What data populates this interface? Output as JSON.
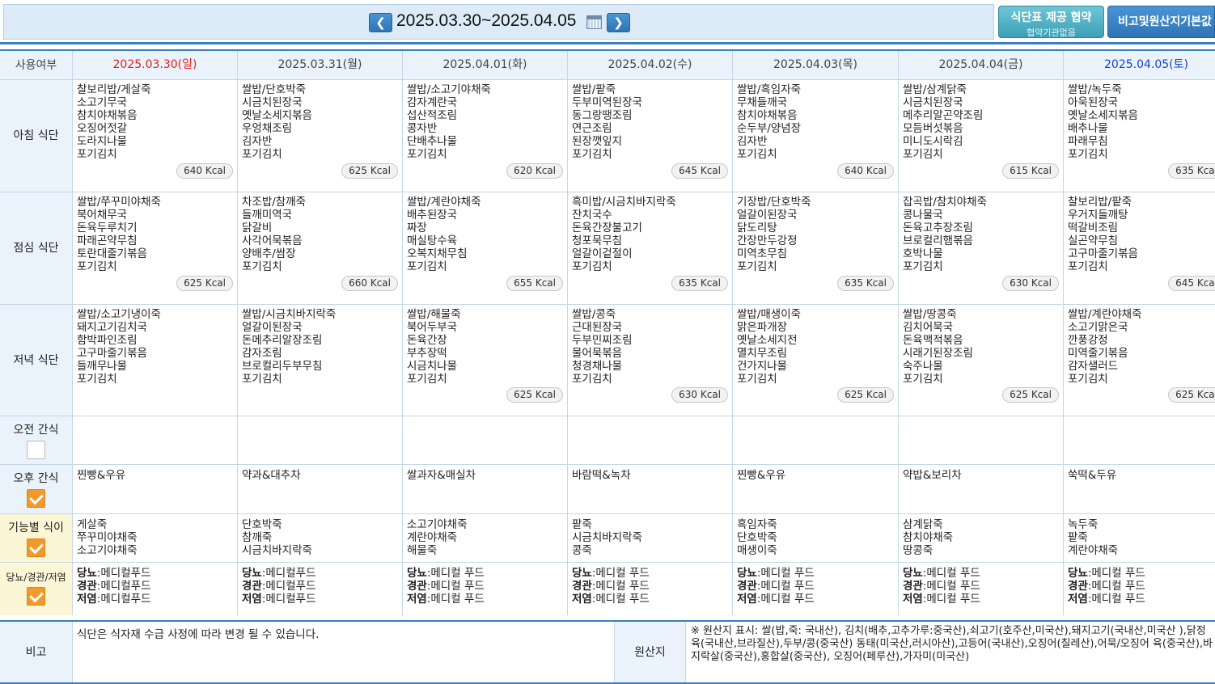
{
  "header": {
    "prev_icon": "chevron-left-icon",
    "next_icon": "chevron-right-icon",
    "prev_glyph": "❮",
    "next_glyph": "❯",
    "date_range": "2025.03.30~2025.04.05",
    "agree_button_title": "식단표 제공 협약",
    "agree_button_sub": "협약기관없음",
    "note_button": "비고및원산지기본값"
  },
  "table": {
    "col_header_label": "사용여부",
    "days": [
      {
        "date": "2025.03.30(일)",
        "kind": "sun"
      },
      {
        "date": "2025.03.31(월)",
        "kind": ""
      },
      {
        "date": "2025.04.01(화)",
        "kind": ""
      },
      {
        "date": "2025.04.02(수)",
        "kind": ""
      },
      {
        "date": "2025.04.03(목)",
        "kind": ""
      },
      {
        "date": "2025.04.04(금)",
        "kind": ""
      },
      {
        "date": "2025.04.05(토)",
        "kind": "sat"
      }
    ],
    "rows": {
      "breakfast": {
        "label": "아침 식단",
        "cells": [
          {
            "items": [
              "찰보리밥/게살죽",
              "소고기무국",
              "참치야채볶음",
              "오징어젓갈",
              "도라지나물",
              "포기김치"
            ],
            "kcal": "640 Kcal"
          },
          {
            "items": [
              "쌀밥/단호박죽",
              "시금치된장국",
              "옛날소세지볶음",
              "우엉채조림",
              "김자반",
              "포기김치"
            ],
            "kcal": "625 Kcal"
          },
          {
            "items": [
              "쌀밥/소고기야채죽",
              "감자계란국",
              "섭산적조림",
              "콩자반",
              "단배추나물",
              "포기김치"
            ],
            "kcal": "620 Kcal"
          },
          {
            "items": [
              "쌀밥/팥죽",
              "두부미역된장국",
              "동그랑땡조림",
              "연근조림",
              "된장깻잎지",
              "포기김치"
            ],
            "kcal": "645 Kcal"
          },
          {
            "items": [
              "쌀밥/흑임자죽",
              "무채들깨국",
              "참치야채볶음",
              "순두부/양념장",
              "김자반",
              "포기김치"
            ],
            "kcal": "640 Kcal"
          },
          {
            "items": [
              "쌀밥/삼계닭죽",
              "시금치된장국",
              "메추리알곤약조림",
              "모듬버섯볶음",
              "미니도시락김",
              "포기김치"
            ],
            "kcal": "615 Kcal"
          },
          {
            "items": [
              "쌀밥/녹두죽",
              "아욱된장국",
              "옛날소세지볶음",
              "배추나물",
              "파래무침",
              "포기김치"
            ],
            "kcal": "635 Kcal"
          }
        ]
      },
      "lunch": {
        "label": "점심 식단",
        "cells": [
          {
            "items": [
              "쌀밥/쭈꾸미야채죽",
              "북어채무국",
              "돈육두루치기",
              "파래곤약무침",
              "토란대줄기볶음",
              "포기김치"
            ],
            "kcal": "625 Kcal"
          },
          {
            "items": [
              "차조밥/참깨죽",
              "들깨미역국",
              "닭갈비",
              "사각어묵볶음",
              "양배추/쌈장",
              "포기김치"
            ],
            "kcal": "660 Kcal"
          },
          {
            "items": [
              "쌀밥/계란야채죽",
              "배추된장국",
              "짜장",
              "매실탕수육",
              "오복지채무침",
              "포기김치"
            ],
            "kcal": "655 Kcal"
          },
          {
            "items": [
              "흑미밥/시금치바지락죽",
              "잔치국수",
              "돈육간장불고기",
              "청포묵무침",
              "얼갈이겉절이",
              "포기김치"
            ],
            "kcal": "635 Kcal"
          },
          {
            "items": [
              "기장밥/단호박죽",
              "얼갈이된장국",
              "닭도리탕",
              "간장만두강정",
              "미역초무침",
              "포기김치"
            ],
            "kcal": "635 Kcal"
          },
          {
            "items": [
              "잡곡밥/참치야채죽",
              "콩나물국",
              "돈육고추장조림",
              "브로컬리햄볶음",
              "호박나물",
              "포기김치"
            ],
            "kcal": "630 Kcal"
          },
          {
            "items": [
              "찰보리밥/팥죽",
              "우거지들깨탕",
              "떡갈비조림",
              "실곤약무침",
              "고구마줄기볶음",
              "포기김치"
            ],
            "kcal": "645 Kcal"
          }
        ]
      },
      "dinner": {
        "label": "저녁 식단",
        "cells": [
          {
            "items": [
              "쌀밥/소고기냉이죽",
              "돼지고기김치국",
              "함박파인조림",
              "고구마줄기볶음",
              "들깨무나물",
              "포기김치"
            ],
            "kcal": ""
          },
          {
            "items": [
              "쌀밥/시금치바지락죽",
              "얼갈이된장국",
              "돈메추리알장조림",
              "감자조림",
              "브로컬리두부무침",
              "포기김치"
            ],
            "kcal": ""
          },
          {
            "items": [
              "쌀밥/해물죽",
              "북어두부국",
              "돈육간장",
              "부추장떡",
              "시금치나물",
              "포기김치"
            ],
            "kcal": "625 Kcal"
          },
          {
            "items": [
              "쌀밥/콩죽",
              "근대된장국",
              "두부민찌조림",
              "물어묵볶음",
              "청경채나물",
              "포기김치"
            ],
            "kcal": "630 Kcal"
          },
          {
            "items": [
              "쌀밥/매생이죽",
              "맑은파개장",
              "옛날소세지전",
              "멸치무조림",
              "건가지나물",
              "포기김치"
            ],
            "kcal": "625 Kcal"
          },
          {
            "items": [
              "쌀밥/땅콩죽",
              "김치어묵국",
              "돈육맥적볶음",
              "시래기된장조림",
              "숙주나물",
              "포기김치"
            ],
            "kcal": "625 Kcal"
          },
          {
            "items": [
              "쌀밥/계란야채죽",
              "소고기맑은국",
              "깐풍강정",
              "미역줄기볶음",
              "감자샐러드",
              "포기김치"
            ],
            "kcal": "625 Kcal"
          }
        ]
      },
      "am_snack": {
        "label": "오전 간식",
        "checked": false,
        "cells": [
          [],
          [],
          [],
          [],
          [],
          [],
          []
        ]
      },
      "pm_snack": {
        "label": "오후 간식",
        "checked": true,
        "cells": [
          [
            "찐빵&우유"
          ],
          [
            "약과&대추차"
          ],
          [
            "쌀과자&매실차"
          ],
          [
            "바람떡&녹차"
          ],
          [
            "찐빵&우유"
          ],
          [
            "약밥&보리차"
          ],
          [
            "쑥떡&두유"
          ]
        ]
      },
      "functional": {
        "label": "기능별 식이",
        "checked": true,
        "cells": [
          [
            "게살죽",
            "쭈꾸미야채죽",
            "소고기야채죽"
          ],
          [
            "단호박죽",
            "참깨죽",
            "시금치바지락죽"
          ],
          [
            "소고기야채죽",
            "계란야채죽",
            "해물죽"
          ],
          [
            "팥죽",
            "시금치바지락죽",
            "콩죽"
          ],
          [
            "흑임자죽",
            "단호박죽",
            "매생이죽"
          ],
          [
            "삼계닭죽",
            "참치야채죽",
            "땅콩죽"
          ],
          [
            "녹두죽",
            "팥죽",
            "계란야채죽"
          ]
        ]
      },
      "therapeutic": {
        "label": "당뇨/경관/저염",
        "checked": true,
        "cells": [
          [
            {
              "k": "당뇨",
              "v": ":메디컬푸드"
            },
            {
              "k": "경관",
              "v": ":메디컬푸드"
            },
            {
              "k": "저염",
              "v": ":메디컬푸드"
            }
          ],
          [
            {
              "k": "당뇨",
              "v": ":메디컬푸드"
            },
            {
              "k": "경관",
              "v": ":메디컬푸드"
            },
            {
              "k": "저염",
              "v": ":메디컬푸드"
            }
          ],
          [
            {
              "k": "당뇨",
              "v": ":메디컬 푸드"
            },
            {
              "k": "경관",
              "v": ":메디컬 푸드"
            },
            {
              "k": "저염",
              "v": ":메디컬 푸드"
            }
          ],
          [
            {
              "k": "당뇨",
              "v": ":메디컬 푸드"
            },
            {
              "k": "경관",
              "v": ":메디컬 푸드"
            },
            {
              "k": "저염",
              "v": ":메디컬 푸드"
            }
          ],
          [
            {
              "k": "당뇨",
              "v": ":메디컬 푸드"
            },
            {
              "k": "경관",
              "v": ":메디컬 푸드"
            },
            {
              "k": "저염",
              "v": ":메디컬 푸드"
            }
          ],
          [
            {
              "k": "당뇨",
              "v": ":메디컬 푸드"
            },
            {
              "k": "경관",
              "v": ":메디컬 푸드"
            },
            {
              "k": "저염",
              "v": ":메디컬 푸드"
            }
          ],
          [
            {
              "k": "당뇨",
              "v": ":메디컬 푸드"
            },
            {
              "k": "경관",
              "v": ":메디컬 푸드"
            },
            {
              "k": "저염",
              "v": ":메디컬 푸드"
            }
          ]
        ]
      }
    },
    "dinner_kcal_visible": [
      "",
      "",
      "625 Kcal",
      "630 Kcal",
      "625 Kcal",
      "625 Kcal",
      "625 Kcal"
    ]
  },
  "footer": {
    "note_label": "비고",
    "note_text": "식단은 식자재 수급 사정에 따라 변경 될 수 있습니다.",
    "origin_label": "원산지",
    "origin_text": "※ 원산지 표시: 쌀(밥,죽: 국내산), 김치(배추,고추가루:중국산),쇠고기(호주산,미국산),돼지고기(국내산,미국산 ),닭정육(국내산,브라질산),두부/콩(중국산) 동태(미국산,러시아산),고등어(국내산),오징어(칠레산),어묵/오징어 육(중국산),바지락살(중국산),홍합살(중국산), 오징어(페루산),가자미(미국산)"
  }
}
